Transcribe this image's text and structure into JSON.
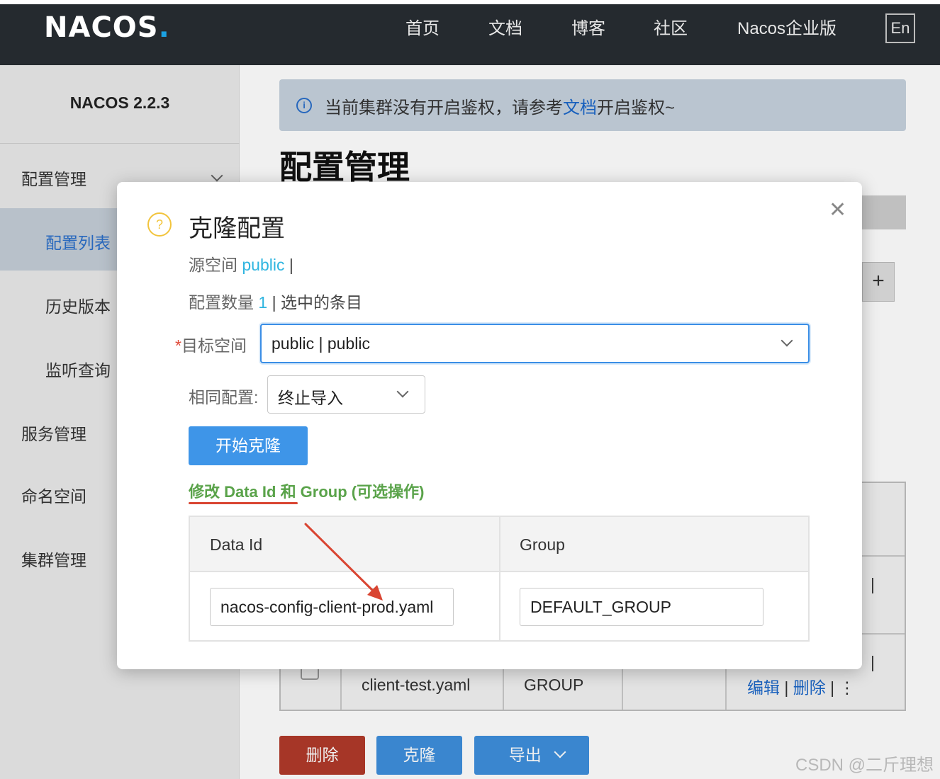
{
  "brand": {
    "logo_left": "NA",
    "logo_c": "C",
    "logo_right": "OS",
    "logo_dot": "."
  },
  "nav": {
    "items": [
      "首页",
      "文档",
      "博客",
      "社区",
      "Nacos企业版"
    ],
    "lang": "En"
  },
  "sidebar": {
    "version": "NACOS 2.2.3",
    "items": [
      {
        "label": "配置管理"
      },
      {
        "label": "配置列表"
      },
      {
        "label": "历史版本"
      },
      {
        "label": "监听查询"
      },
      {
        "label": "服务管理"
      },
      {
        "label": "命名空间"
      },
      {
        "label": "集群管理"
      }
    ]
  },
  "notice": {
    "before": "当前集群没有开启鉴权，请参考",
    "link": "文档",
    "after": "开启鉴权~"
  },
  "page_title": "配置管理",
  "bg_table": {
    "row_frag_1": "| ",
    "row_frag_2": "| ",
    "data_id": "client-test.yaml",
    "group": "GROUP",
    "edit": "编辑",
    "sep": " | ",
    "delete": "删除",
    "more": " | ⋮"
  },
  "bottom_buttons": {
    "delete": "删除",
    "clone": "克隆",
    "export": "导出"
  },
  "dialog": {
    "title": "克隆配置",
    "source_label": "源空间",
    "source_value": "public",
    "source_sep": "|",
    "count_label": "配置数量",
    "count_value": "1",
    "count_suffix": "| 选中的条目",
    "target_label": "目标空间",
    "target_required": "*",
    "target_value": "public | public",
    "same_label": "相同配置:",
    "same_value": "终止导入",
    "start_button": "开始克隆",
    "modify_note": "修改 Data Id 和 Group (可选操作)",
    "table": {
      "col_data_id": "Data Id",
      "col_group": "Group",
      "data_id_value": "nacos-config-client-prod.yaml",
      "group_value": "DEFAULT_GROUP"
    }
  },
  "watermark": "CSDN @二斤理想",
  "colors": {
    "topbar": "#252a2f",
    "primary": "#3e95e8",
    "danger": "#b13a2a",
    "note_green": "#5aa34a",
    "annot_red": "#d94532"
  }
}
